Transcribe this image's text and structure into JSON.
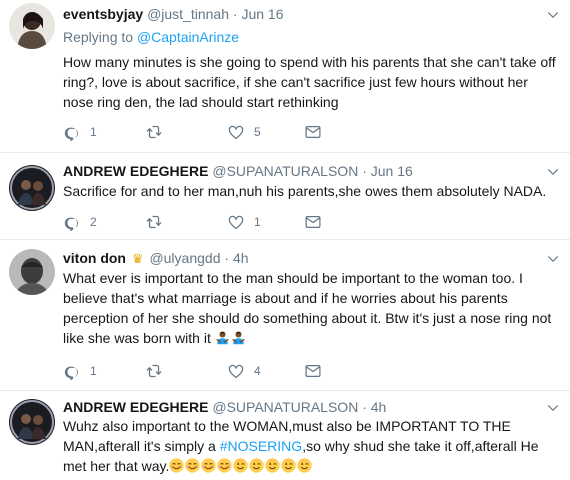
{
  "tweets": [
    {
      "name": "eventsbyjay",
      "handle": "@just_tinnah",
      "sep": "·",
      "date": "Jun 16",
      "replying_prefix": "Replying to ",
      "replying_to": "@CaptainArinze",
      "text": "How many minutes is she going to spend with his parents that she can't take off ring?, love is about sacrifice, if she can't sacrifice just few hours without her nose ring den, the lad should start rethinking",
      "replies": "1",
      "retweets": "",
      "likes": "5"
    },
    {
      "name": "ANDREW EDEGHERE",
      "handle": "@SUPANATURALSON",
      "sep": "·",
      "date": "Jun 16",
      "text": "Sacrifice for and to her man,nuh his parents,she owes them absolutely NADA.",
      "replies": "2",
      "retweets": "",
      "likes": "1"
    },
    {
      "name": "viton don",
      "handle": "@ulyangdd",
      "sep": "·",
      "date": "4h",
      "text": "What ever is important to the man should be important to the woman too. I believe that's what marriage is about and if he worries about his parents perception of her she should do something about it. Btw it's just a nose ring not like she was born with it",
      "replies": "1",
      "retweets": "",
      "likes": "4"
    },
    {
      "name": "ANDREW EDEGHERE",
      "handle": "@SUPANATURALSON",
      "sep": "·",
      "date": "4h",
      "text_before": "Wuhz also important to the WOMAN,must also be IMPORTANT TO THE MAN,afterall it's simply a ",
      "hashtag": "#NOSERING",
      "text_after": ",so why shud she take it off,afterall He met her that way."
    }
  ],
  "colors": {
    "accent": "#1da1f2",
    "meta": "#657786",
    "text": "#14171a",
    "divider": "#e6ecf0"
  },
  "icons": [
    "chevron-down-icon",
    "reply-icon",
    "retweet-icon",
    "like-icon",
    "dm-icon",
    "crown-icon",
    "smiling-emoji",
    "winking-emoji",
    "man-gesturing-emoji"
  ]
}
